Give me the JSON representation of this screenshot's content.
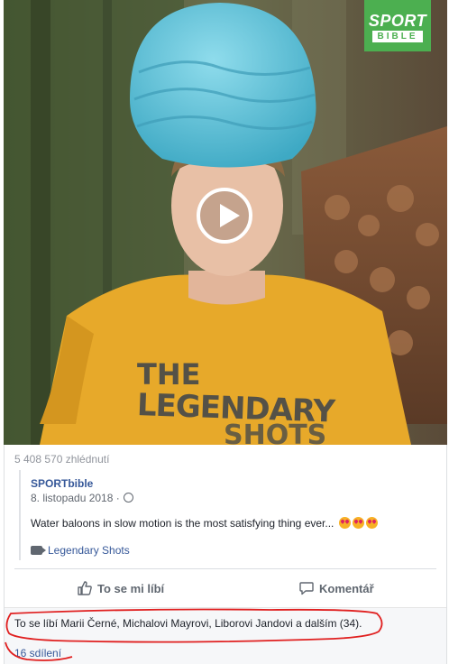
{
  "video": {
    "brand_line1": "SPORT",
    "brand_line2": "BIBLE",
    "shirt_line1": "THE",
    "shirt_line2": "LEGENDARY",
    "shirt_line3": "SHOTS",
    "play_icon": "play-circle-icon"
  },
  "stats": {
    "views": "5 408 570 zhlédnutí"
  },
  "post": {
    "page_name": "SPORTbible",
    "date": "8. listopadu 2018 ·",
    "globe_icon": "globe-icon",
    "text": "Water baloons in slow motion is the most satisfying thing ever...",
    "emoji_icon": "heart-eyes-emoji",
    "series": "Legendary Shots",
    "series_icon": "video-camera-icon"
  },
  "actions": {
    "like_label": "To se mi líbí",
    "like_icon": "thumbs-up-icon",
    "comment_label": "Komentář",
    "comment_icon": "speech-bubble-icon"
  },
  "engagement": {
    "likes_text": "To se líbí Marii Černé, Michalovi Mayrovi, Liborovi Jandovi a dalším (34).",
    "shares_text": "16 sdílení"
  },
  "colors": {
    "brand_green": "#4caf50",
    "link_blue": "#365899",
    "annotation_red": "#e02020",
    "shirt_yellow": "#e7a92a",
    "balloon_blue": "#5bbfd4"
  }
}
